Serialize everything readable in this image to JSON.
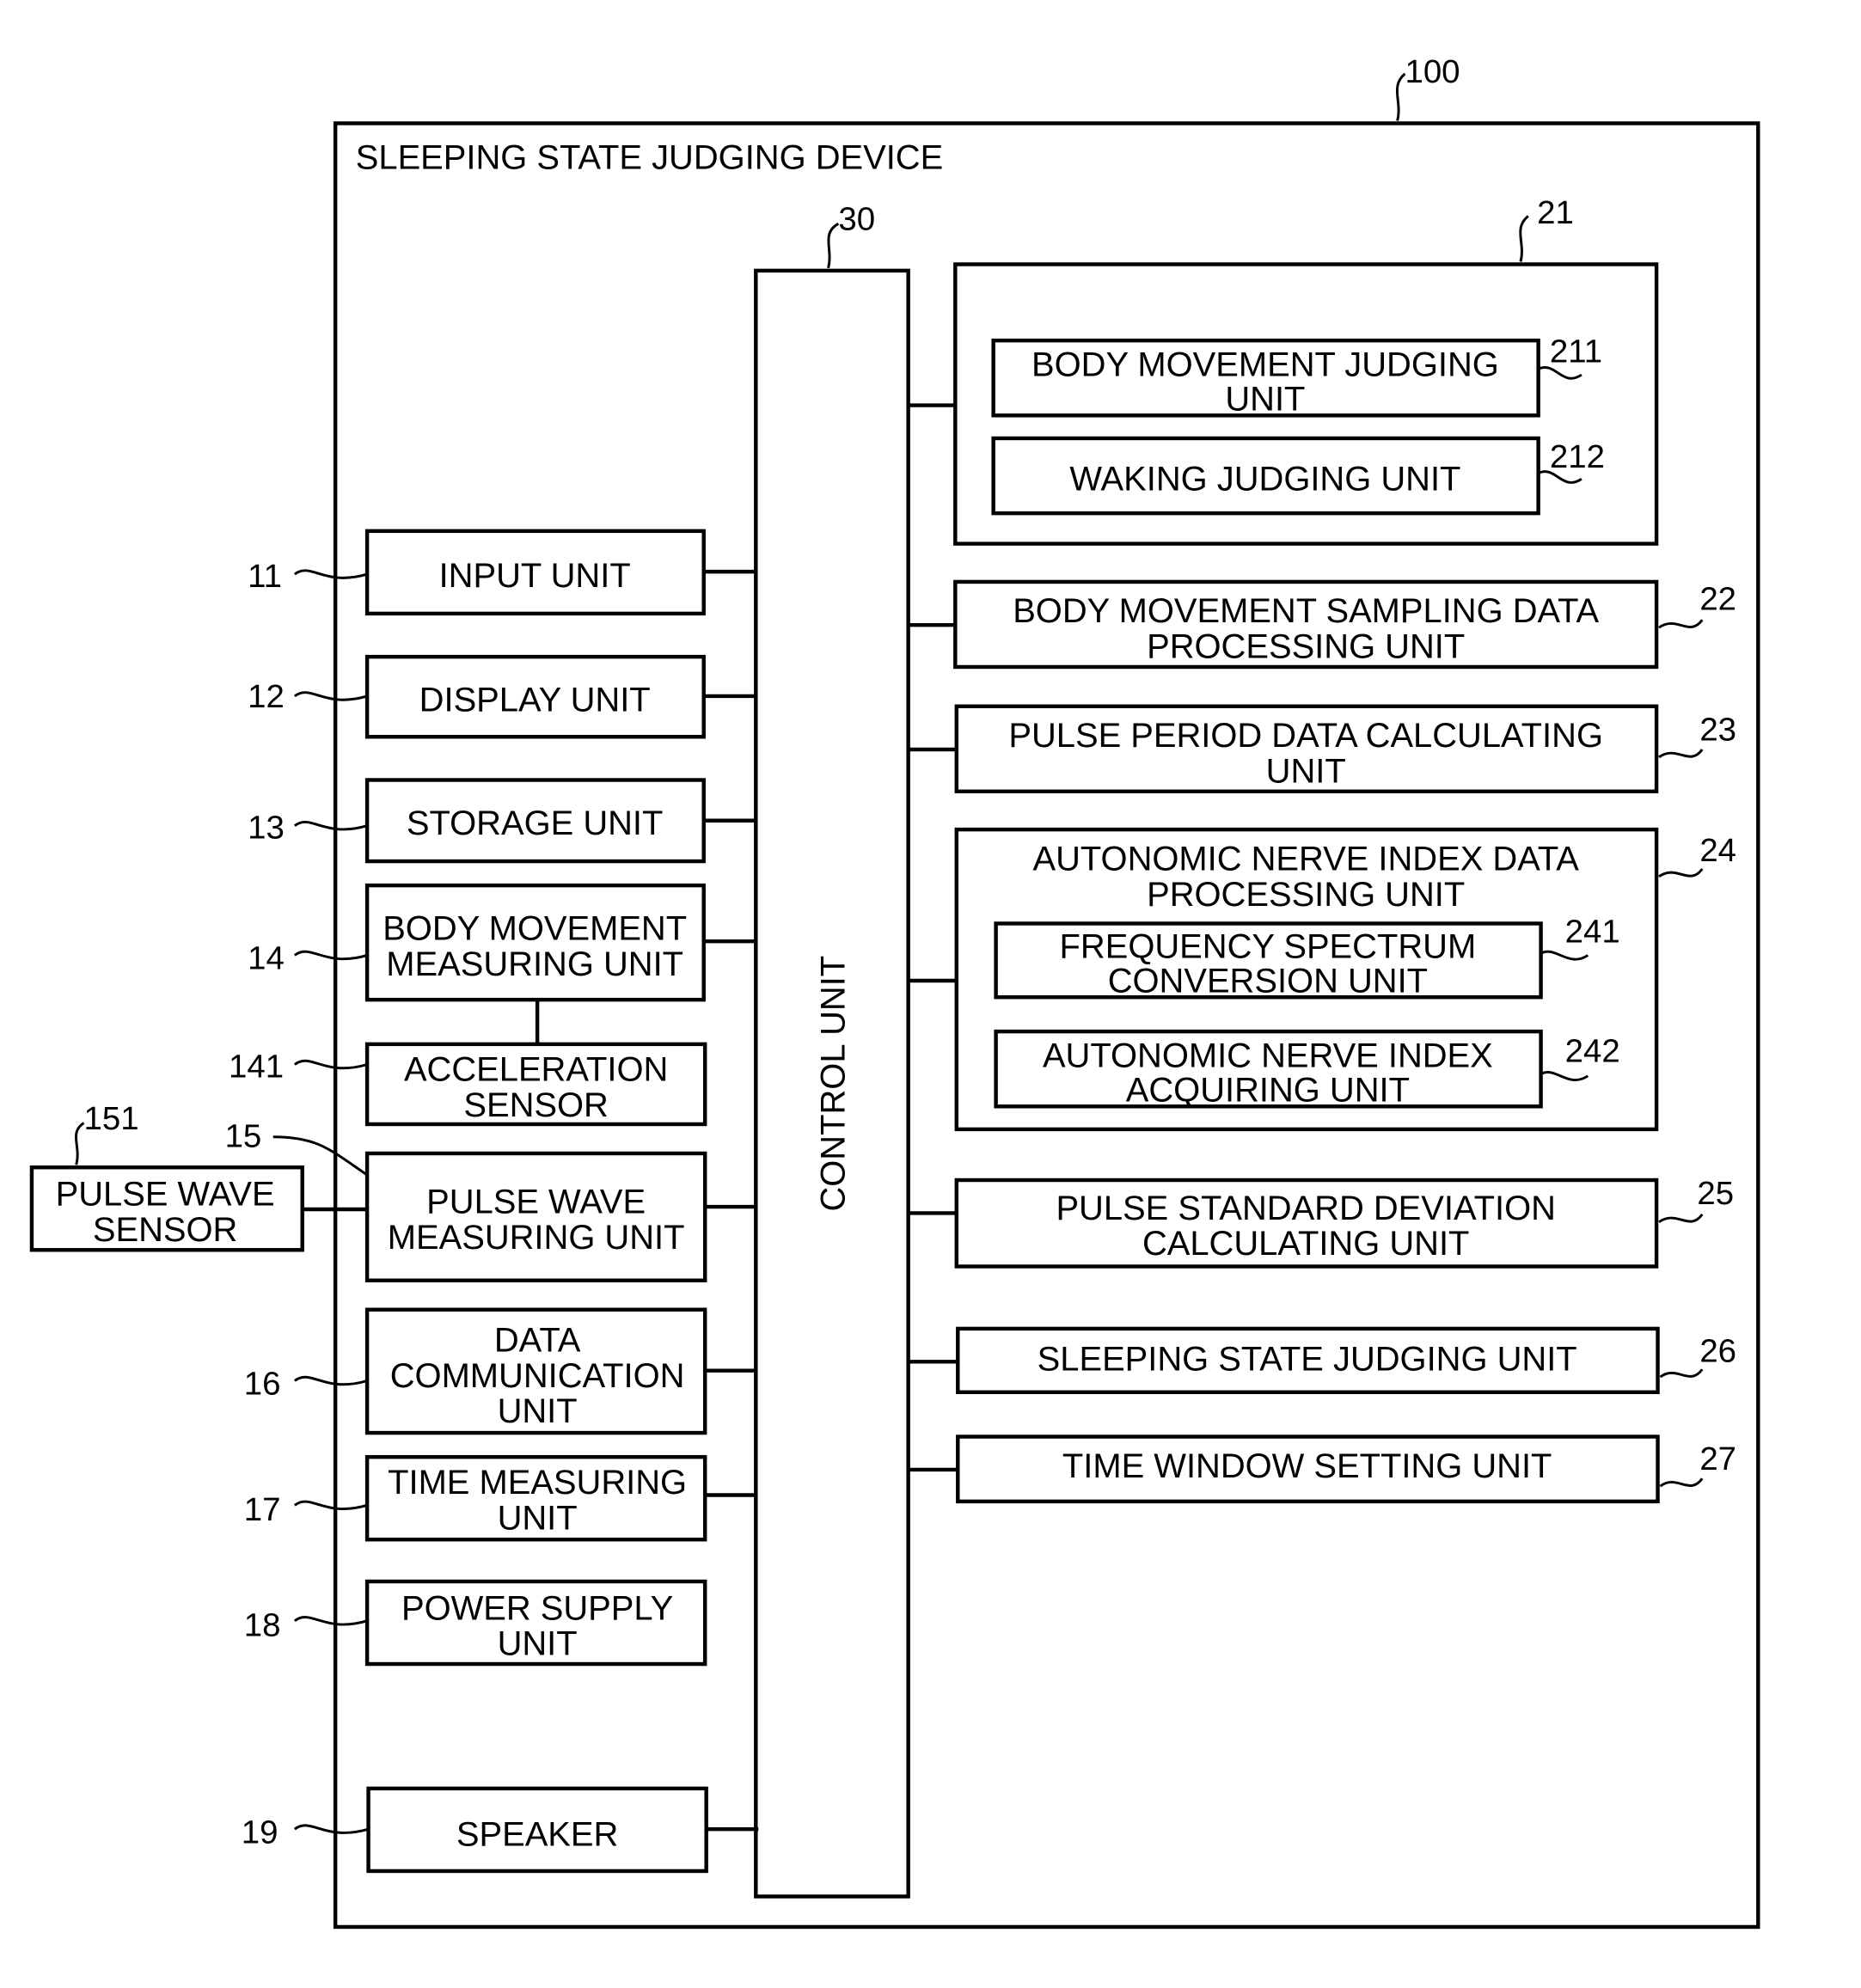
{
  "device": {
    "ref": "100",
    "title": "SLEEPING STATE JUDGING DEVICE"
  },
  "control": {
    "ref": "30",
    "label": "CONTROL UNIT"
  },
  "left_units": [
    {
      "ref": "11",
      "lines": [
        "INPUT UNIT"
      ]
    },
    {
      "ref": "12",
      "lines": [
        "DISPLAY UNIT"
      ]
    },
    {
      "ref": "13",
      "lines": [
        "STORAGE UNIT"
      ]
    },
    {
      "ref": "14",
      "lines": [
        "BODY MOVEMENT",
        "MEASURING UNIT"
      ]
    },
    {
      "ref": "141",
      "lines": [
        "ACCELERATION",
        "SENSOR"
      ]
    },
    {
      "ref": "15",
      "lines": [
        "PULSE WAVE",
        "MEASURING UNIT"
      ]
    },
    {
      "ref": "16",
      "lines": [
        "DATA",
        "COMMUNICATION",
        "UNIT"
      ]
    },
    {
      "ref": "17",
      "lines": [
        "TIME MEASURING",
        "UNIT"
      ]
    },
    {
      "ref": "18",
      "lines": [
        "POWER SUPPLY",
        "UNIT"
      ]
    },
    {
      "ref": "19",
      "lines": [
        "SPEAKER"
      ]
    }
  ],
  "external": {
    "ref": "151",
    "lines": [
      "PULSE WAVE",
      "SENSOR"
    ]
  },
  "right_units": {
    "u21": {
      "ref": "21",
      "children": [
        {
          "ref": "211",
          "lines": [
            "BODY MOVEMENT JUDGING",
            "UNIT"
          ]
        },
        {
          "ref": "212",
          "lines": [
            "WAKING JUDGING UNIT"
          ]
        }
      ]
    },
    "u22": {
      "ref": "22",
      "lines": [
        "BODY MOVEMENT SAMPLING DATA",
        "PROCESSING UNIT"
      ]
    },
    "u23": {
      "ref": "23",
      "lines": [
        "PULSE PERIOD DATA CALCULATING",
        "UNIT"
      ]
    },
    "u24": {
      "ref": "24",
      "lines": [
        "AUTONOMIC NERVE INDEX DATA",
        "PROCESSING UNIT"
      ],
      "children": [
        {
          "ref": "241",
          "lines": [
            "FREQUENCY SPECTRUM",
            "CONVERSION UNIT"
          ]
        },
        {
          "ref": "242",
          "lines": [
            "AUTONOMIC NERVE INDEX",
            "ACQUIRING UNIT"
          ]
        }
      ]
    },
    "u25": {
      "ref": "25",
      "lines": [
        "PULSE STANDARD DEVIATION",
        "CALCULATING UNIT"
      ]
    },
    "u26": {
      "ref": "26",
      "lines": [
        "SLEEPING STATE JUDGING UNIT"
      ]
    },
    "u27": {
      "ref": "27",
      "lines": [
        "TIME WINDOW SETTING UNIT"
      ]
    }
  }
}
